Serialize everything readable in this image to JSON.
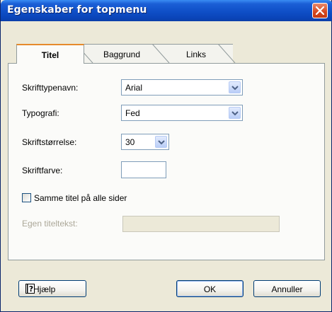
{
  "window": {
    "title": "Egenskaber for topmenu"
  },
  "tabs": [
    {
      "label": "Titel",
      "active": true
    },
    {
      "label": "Baggrund",
      "active": false
    },
    {
      "label": "Links",
      "active": false
    }
  ],
  "fields": {
    "font_name": {
      "label": "Skrifttypenavn:",
      "value": "Arial"
    },
    "typography": {
      "label": "Typografi:",
      "value": "Fed"
    },
    "font_size": {
      "label": "Skriftstørrelse:",
      "value": "30"
    },
    "font_color": {
      "label": "Skriftfarve:",
      "value": "#ffffff"
    },
    "same_title": {
      "label": "Samme titel på alle sider",
      "checked": false
    },
    "own_title": {
      "label": "Egen titeltekst:",
      "value": "",
      "disabled": true
    }
  },
  "buttons": {
    "help": "Hjælp",
    "ok": "OK",
    "cancel": "Annuller"
  },
  "colors": {
    "title_bar": "#0f4fc7",
    "close_button": "#d4471e",
    "active_tab_accent": "#e68b2c",
    "dialog_bg": "#ece9d8"
  }
}
